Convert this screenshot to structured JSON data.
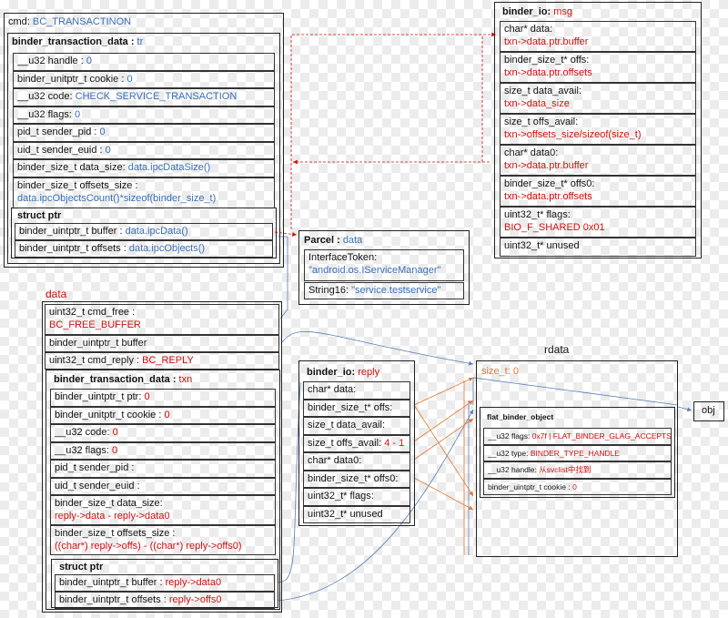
{
  "cmd": {
    "label": "cmd:",
    "value": "BC_TRANSACTINON"
  },
  "tr": {
    "title": "binder_transaction_data",
    "name": "tr",
    "rows": [
      {
        "k": "__u32 handle :",
        "v": "0"
      },
      {
        "k": "binder_unitptr_t cookie :",
        "v": "0"
      },
      {
        "k": "__u32 code:",
        "v": "CHECK_SERVICE_TRANSACTION"
      },
      {
        "k": "__u32 flags:",
        "v": "0"
      },
      {
        "k": "pid_t sender_pid :",
        "v": "0"
      },
      {
        "k": "uid_t sender_euid :",
        "v": "0"
      },
      {
        "k": "binder_size_t data_size:",
        "v": "data.ipcDataSize()"
      },
      {
        "k": "binder_size_t offsets_size :",
        "v": "data.ipcObjectsCount()*sizeof(binder_size_t)"
      }
    ],
    "ptr": {
      "title": "struct ptr",
      "rows": [
        {
          "k": "binder_uintptr_t buffer :",
          "v": "data.ipcData()"
        },
        {
          "k": "binder_uintptr_t offsets :",
          "v": "data.ipcObjects()"
        }
      ]
    }
  },
  "parcel": {
    "title": "Parcel",
    "name": "data",
    "rows": [
      {
        "k": "InterfaceToken:",
        "v": "\"android.os.IServiceManager\""
      },
      {
        "k": "String16:",
        "v": "\"service.testservice\""
      }
    ]
  },
  "msg": {
    "title": "binder_io:",
    "name": "msg",
    "rows": [
      {
        "k": "char* data:",
        "v": "txn->data.ptr.buffer"
      },
      {
        "k": "binder_size_t* offs:",
        "v": "txn->data.ptr.offsets"
      },
      {
        "k": "size_t data_avail:",
        "v": "txn->data_size"
      },
      {
        "k": "size_t offs_avail:",
        "v": "txn->offsets_size/sizeof(size_t)"
      },
      {
        "k": "char* data0:",
        "v": "txn->data.ptr.buffer"
      },
      {
        "k": "binder_size_t* offs0:",
        "v": "txn->data.ptr.offsets"
      },
      {
        "k": "uint32_t* flags:",
        "v": "BIO_F_SHARED 0x01"
      },
      {
        "k": "uint32_t* unused",
        "v": ""
      }
    ]
  },
  "data_block": {
    "label": "data",
    "rows": [
      {
        "k": "uint32_t cmd_free :",
        "v": "BC_FREE_BUFFER"
      },
      {
        "k": "binder_uintptr_t buffer",
        "v": ""
      },
      {
        "k": "uint32_t cmd_reply :",
        "v": "BC_REPLY"
      }
    ],
    "txn": {
      "title": "binder_transaction_data",
      "name": "txn",
      "rows": [
        {
          "k": "binder_uintptr_t ptr:",
          "v": "0"
        },
        {
          "k": "binder_unitptr_t cookie :",
          "v": "0"
        },
        {
          "k": "__u32 code:",
          "v": "0"
        },
        {
          "k": "__u32 flags:",
          "v": "0"
        },
        {
          "k": "pid_t sender_pid :",
          "v": ""
        },
        {
          "k": "uid_t sender_euid :",
          "v": ""
        },
        {
          "k": "binder_size_t data_size:",
          "v": "reply->data - reply->data0"
        },
        {
          "k": "binder_size_t offsets_size :",
          "v": "((char*) reply->offs) - ((char*) reply->offs0)"
        }
      ],
      "ptr": {
        "title": "struct ptr",
        "rows": [
          {
            "k": "binder_uintptr_t buffer :",
            "v": "reply->data0"
          },
          {
            "k": "binder_uintptr_t offsets :",
            "v": "reply->offs0"
          }
        ]
      }
    }
  },
  "reply": {
    "title": "binder_io:",
    "name": "reply",
    "rows": [
      {
        "k": "char* data:",
        "v": ""
      },
      {
        "k": "binder_size_t* offs:",
        "v": ""
      },
      {
        "k": "size_t data_avail:",
        "v": ""
      },
      {
        "k": "size_t offs_avail:",
        "v": "4 - 1"
      },
      {
        "k": "char* data0:",
        "v": ""
      },
      {
        "k": "binder_size_t* offs0:",
        "v": ""
      },
      {
        "k": "uint32_t* flags:",
        "v": ""
      },
      {
        "k": "uint32_t* unused",
        "v": ""
      }
    ]
  },
  "rdata": {
    "label": "rdata",
    "size": "size_t: 0",
    "fbo": {
      "title": "flat_binder_object",
      "rows": [
        {
          "k": "__u32 flags:",
          "v": "0x7f | FLAT_BINDER_GLAG_ACCEPTS_FDS"
        },
        {
          "k": "__u32 type:",
          "v": "BINDER_TYPE_HANDLE"
        },
        {
          "k": "__u32 handle:",
          "v": "从svclist中找到"
        },
        {
          "k": "binder_uintptr_t cookie :",
          "v": "0"
        }
      ]
    }
  },
  "obj": {
    "label": "obj"
  },
  "colors": {
    "red": "#d01010",
    "blue": "#3a6fb5",
    "orange": "#e07830",
    "arrow": "#5a7fb5"
  }
}
